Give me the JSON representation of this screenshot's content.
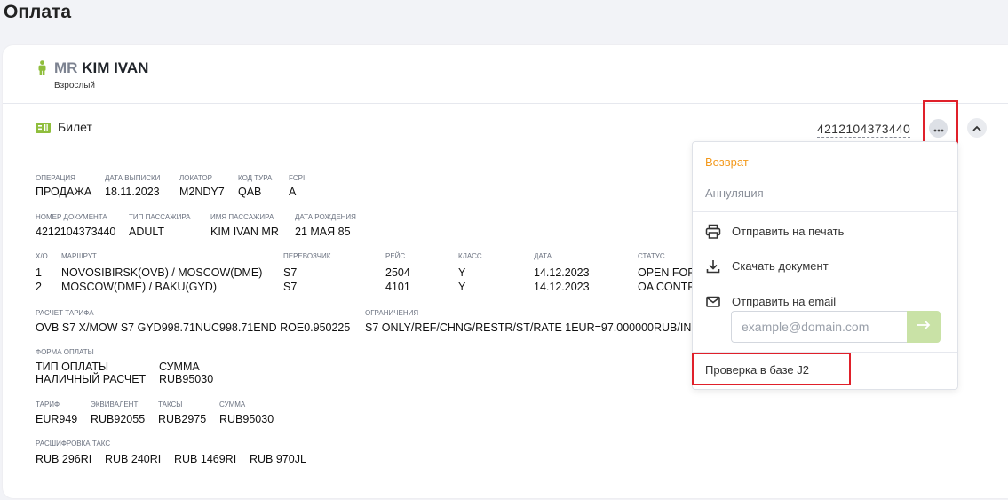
{
  "page": {
    "title": "Оплата"
  },
  "passenger": {
    "title": "MR",
    "name": "KIM IVAN",
    "type": "Взрослый"
  },
  "ticket": {
    "label": "Билет",
    "number": "4212104373440"
  },
  "info1": {
    "operation_label": "ОПЕРАЦИЯ",
    "operation": "ПРОДАЖА",
    "issue_date_label": "ДАТА ВЫПИСКИ",
    "issue_date": "18.11.2023",
    "locator_label": "ЛОКАТОР",
    "locator": "M2NDY7",
    "tour_code_label": "КОД ТУРА",
    "tour_code": "QAB",
    "fcpi_label": "FCPI",
    "fcpi": "A"
  },
  "info2": {
    "doc_number_label": "НОМЕР ДОКУМЕНТА",
    "doc_number": "4212104373440",
    "pax_type_label": "ТИП ПАССАЖИРА",
    "pax_type": "ADULT",
    "pax_name_label": "ИМЯ ПАССАЖИРА",
    "pax_name": "KIM IVAN MR",
    "birth_date_label": "ДАТА РОЖДЕНИЯ",
    "birth_date": "21 МАЯ 85"
  },
  "route": {
    "headers": {
      "xo": "Х/О",
      "route": "МАРШРУТ",
      "carrier": "ПЕРЕВОЗЧИК",
      "flight": "РЕЙС",
      "class": "КЛАСС",
      "date": "ДАТА",
      "status": "СТАТУС"
    },
    "rows": [
      {
        "xo": "1",
        "route": "NOVOSIBIRSK(OVB) / MOSCOW(DME)",
        "carrier": "S7",
        "flight": "2504",
        "class": "Y",
        "date": "14.12.2023",
        "status": "OPEN FOR USE"
      },
      {
        "xo": "2",
        "route": "MOSCOW(DME) / BAKU(GYD)",
        "carrier": "S7",
        "flight": "4101",
        "class": "Y",
        "date": "14.12.2023",
        "status": "OA CONTROL"
      }
    ]
  },
  "fare": {
    "calc_label": "РАСЧЕТ ТАРИФА",
    "calc": "OVB S7 X/MOW S7 GYD998.71NUC998.71END ROE0.950225",
    "restrictions_label": "ОГРАНИЧЕНИЯ",
    "restrictions": "S7 ONLY/REF/CHNG/RESTR/ST/RATE 1EUR=97.000000RUB/IN"
  },
  "payment": {
    "form_label": "ФОРМА ОПЛАТЫ",
    "type_header": "ТИП ОПЛАТЫ",
    "sum_header": "СУММА",
    "type": "НАЛИЧНЫЙ РАСЧЕТ",
    "sum": "RUB95030"
  },
  "amounts": {
    "tariff_label": "ТАРИФ",
    "tariff": "EUR949",
    "equiv_label": "ЭКВИВАЛЕНТ",
    "equiv": "RUB92055",
    "taxes_label": "ТАКСЫ",
    "taxes": "RUB2975",
    "sum_label": "СУММА",
    "sum": "RUB95030"
  },
  "tax_breakdown": {
    "label": "РАСШИФРОВКА ТАКС",
    "items": [
      "RUB 296RI",
      "RUB 240RI",
      "RUB 1469RI",
      "RUB 970JL"
    ]
  },
  "menu": {
    "refund": "Возврат",
    "cancel": "Аннуляция",
    "print": "Отправить на печать",
    "download": "Скачать документ",
    "email": "Отправить на email",
    "email_placeholder": "example@domain.com",
    "check_j2": "Проверка в базе J2"
  },
  "colors": {
    "accent_green": "#8fbe3c",
    "refund_orange": "#f39a1e",
    "highlight_red": "#e0202a"
  },
  "icons": [
    "person-icon",
    "ticket-icon",
    "more-icon",
    "chevron-up-icon",
    "printer-icon",
    "download-icon",
    "mail-icon",
    "arrow-right-icon"
  ]
}
